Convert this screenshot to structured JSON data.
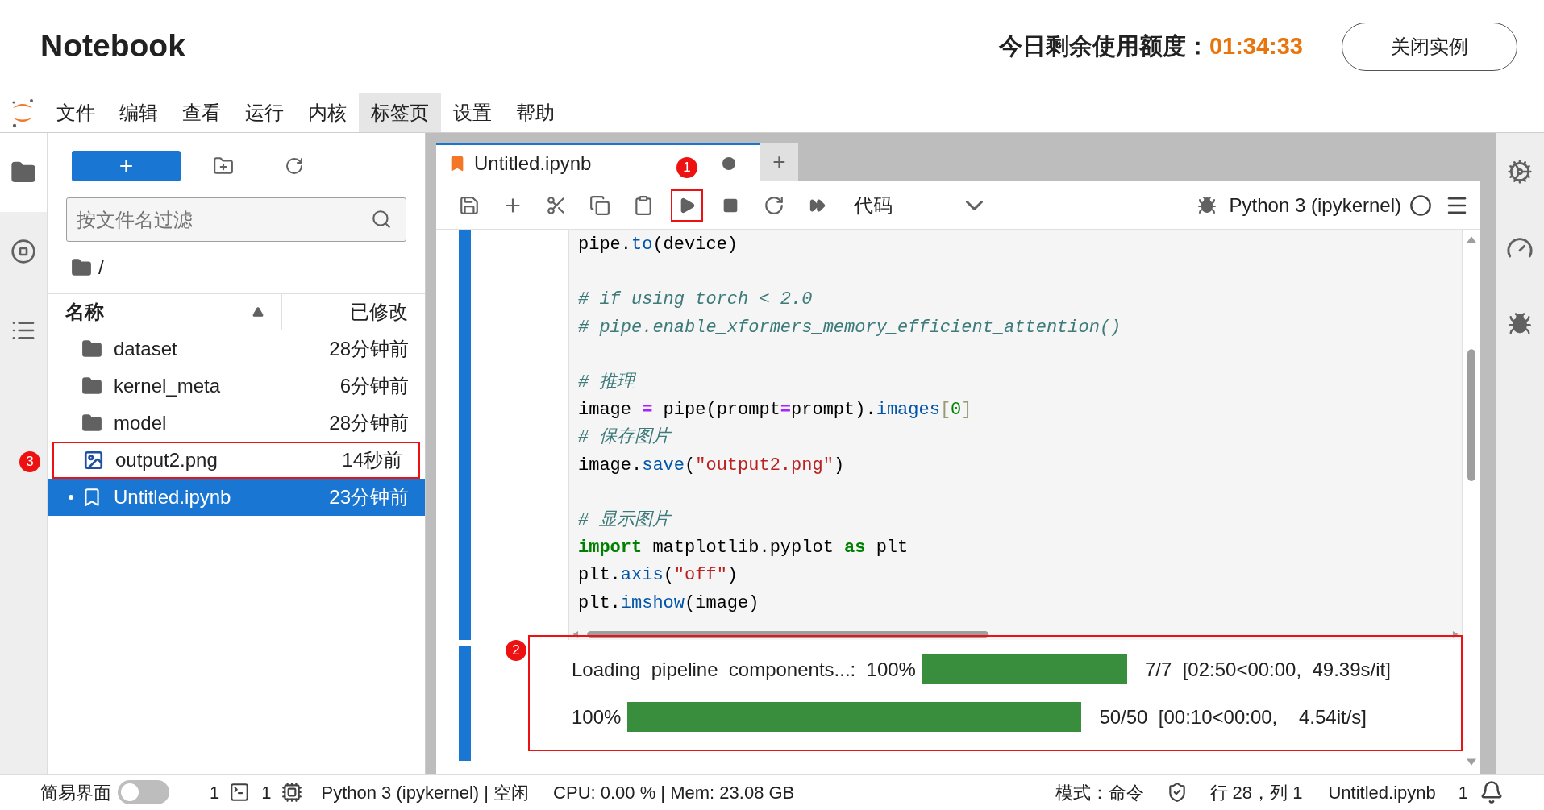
{
  "header": {
    "title": "Notebook",
    "quota_label": "今日剩余使用额度：",
    "quota_time": "01:34:33",
    "close_button": "关闭实例"
  },
  "menu": [
    {
      "label": "文件",
      "selected": false
    },
    {
      "label": "编辑",
      "selected": false
    },
    {
      "label": "查看",
      "selected": false
    },
    {
      "label": "运行",
      "selected": false
    },
    {
      "label": "内核",
      "selected": false
    },
    {
      "label": "标签页",
      "selected": true
    },
    {
      "label": "设置",
      "selected": false
    },
    {
      "label": "帮助",
      "selected": false
    }
  ],
  "activity_bar": [
    {
      "kind": "files",
      "selected": true
    },
    {
      "kind": "running",
      "selected": false
    },
    {
      "kind": "toc",
      "selected": false
    }
  ],
  "file_browser": {
    "new_button": "+",
    "filter_placeholder": "按文件名过滤",
    "path": "/",
    "columns": [
      "名称",
      "已修改"
    ],
    "files": [
      {
        "name": "dataset",
        "modified": "28分钟前",
        "kind": "folder",
        "selected": false,
        "running": false
      },
      {
        "name": "kernel_meta",
        "modified": "6分钟前",
        "kind": "folder",
        "selected": false,
        "running": false
      },
      {
        "name": "model",
        "modified": "28分钟前",
        "kind": "folder",
        "selected": false,
        "running": false
      },
      {
        "name": "output2.png",
        "modified": "14秒前",
        "kind": "image",
        "selected": false,
        "running": false,
        "callout": "3"
      },
      {
        "name": "Untitled.ipynb",
        "modified": "23分钟前",
        "kind": "notebook",
        "selected": true,
        "running": true
      }
    ]
  },
  "notebook": {
    "tab": {
      "title": "Untitled.ipynb",
      "modified": true
    },
    "new_tab": "+",
    "toolbar": {
      "run_callout": "1",
      "cell_type": "代码",
      "kernel": "Python 3 (ipykernel)",
      "kernel_busy": false
    },
    "code": [
      {
        "kind": "code",
        "tokens": [
          {
            "text": "pipe.",
            "kind": "plain"
          },
          {
            "text": "to",
            "kind": "attr"
          },
          {
            "text": "(device)",
            "kind": "plain"
          }
        ]
      },
      {
        "kind": "blank"
      },
      {
        "kind": "code",
        "tokens": [
          {
            "text": "# if using torch < 2.0",
            "kind": "comment"
          }
        ]
      },
      {
        "kind": "code",
        "tokens": [
          {
            "text": "# pipe.enable_xformers_memory_efficient_attention()",
            "kind": "comment"
          }
        ]
      },
      {
        "kind": "blank"
      },
      {
        "kind": "code",
        "tokens": [
          {
            "text": "# 推理",
            "kind": "comment"
          }
        ]
      },
      {
        "kind": "code",
        "tokens": [
          {
            "text": "image ",
            "kind": "plain"
          },
          {
            "text": "=",
            "kind": "op"
          },
          {
            "text": " pipe(prompt",
            "kind": "plain"
          },
          {
            "text": "=",
            "kind": "op"
          },
          {
            "text": "prompt).",
            "kind": "plain"
          },
          {
            "text": "images",
            "kind": "attr"
          },
          {
            "text": "[",
            "kind": "bracket"
          },
          {
            "text": "0",
            "kind": "number"
          },
          {
            "text": "]",
            "kind": "bracket"
          }
        ]
      },
      {
        "kind": "code",
        "tokens": [
          {
            "text": "# 保存图片",
            "kind": "comment"
          }
        ]
      },
      {
        "kind": "code",
        "tokens": [
          {
            "text": "image.",
            "kind": "plain"
          },
          {
            "text": "save",
            "kind": "attr"
          },
          {
            "text": "(",
            "kind": "plain"
          },
          {
            "text": "\"output2.png\"",
            "kind": "string"
          },
          {
            "text": ")",
            "kind": "plain"
          }
        ]
      },
      {
        "kind": "blank"
      },
      {
        "kind": "code",
        "tokens": [
          {
            "text": "# 显示图片",
            "kind": "comment"
          }
        ]
      },
      {
        "kind": "code",
        "tokens": [
          {
            "text": "import",
            "kind": "keyword"
          },
          {
            "text": " matplotlib.pyplot ",
            "kind": "plain"
          },
          {
            "text": "as",
            "kind": "keyword"
          },
          {
            "text": " plt",
            "kind": "plain"
          }
        ]
      },
      {
        "kind": "code",
        "tokens": [
          {
            "text": "plt.",
            "kind": "plain"
          },
          {
            "text": "axis",
            "kind": "attr"
          },
          {
            "text": "(",
            "kind": "plain"
          },
          {
            "text": "\"off\"",
            "kind": "string"
          },
          {
            "text": ")",
            "kind": "plain"
          }
        ]
      },
      {
        "kind": "code",
        "tokens": [
          {
            "text": "plt.",
            "kind": "plain"
          },
          {
            "text": "imshow",
            "kind": "attr"
          },
          {
            "text": "(image)",
            "kind": "plain"
          }
        ]
      }
    ],
    "output": {
      "callout": "2",
      "progress": [
        {
          "label": "Loading  pipeline  components...:  100%",
          "level": 1,
          "stats": "7/7  [02:50<00:00,  49.39s/it]"
        },
        {
          "label": "100%",
          "level": 1,
          "stats": "50/50  [00:10<00:00,    4.54it/s]"
        }
      ]
    }
  },
  "status_bar": {
    "simple_mode": {
      "label": "简易界面",
      "on": false
    },
    "terminal_count": "1",
    "kernel_count": "1",
    "kernel_status": "Python 3 (ipykernel) | 空闲",
    "resources": "CPU: 0.00 % | Mem: 23.08 GB",
    "mode": "模式：命令",
    "cursor": "行 28，列 1",
    "file": "Untitled.ipynb",
    "notifications": "1"
  }
}
